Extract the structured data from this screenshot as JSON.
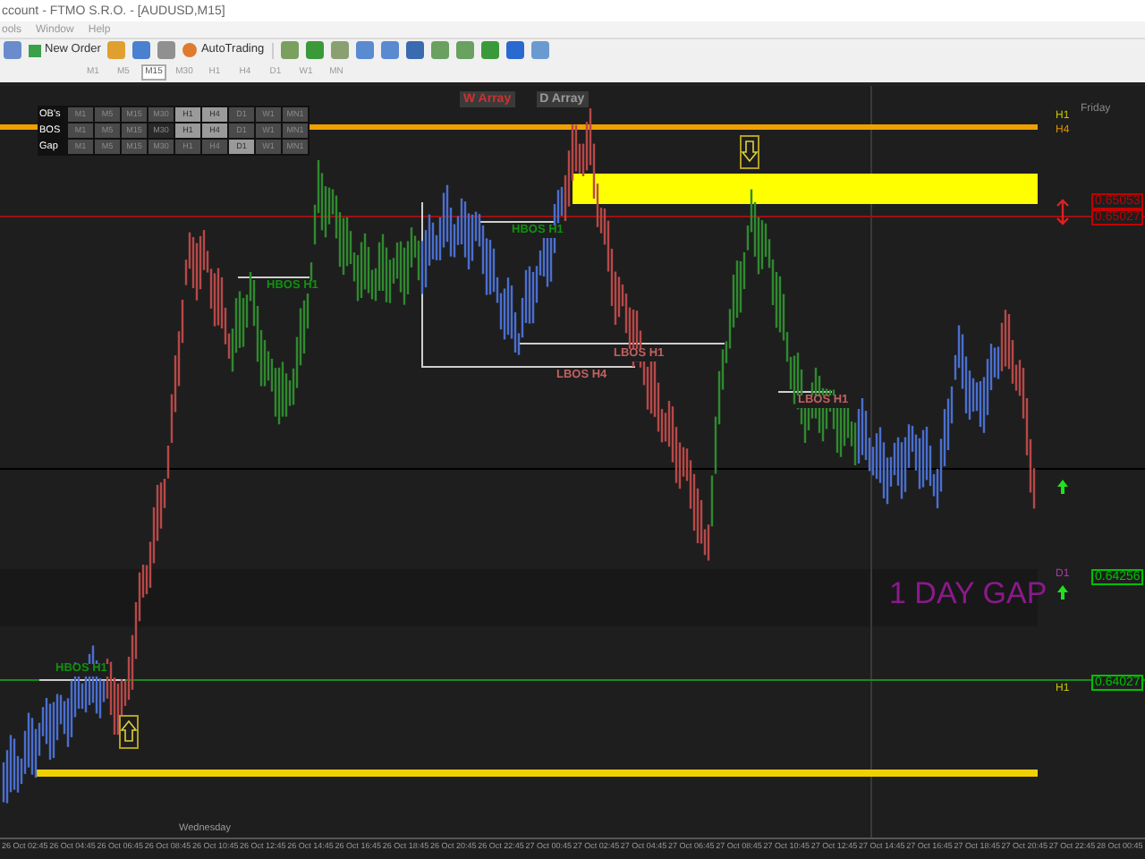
{
  "window": {
    "title": "ccount - FTMO S.R.O. - [AUDUSD,M15]"
  },
  "menu": [
    "ools",
    "Window",
    "Help"
  ],
  "toolbar": {
    "new_order": "New Order",
    "autotrading": "AutoTrading"
  },
  "timeframes": [
    {
      "label": "M1",
      "selected": false
    },
    {
      "label": "M5",
      "selected": false
    },
    {
      "label": "M15",
      "selected": true
    },
    {
      "label": "M30",
      "selected": false
    },
    {
      "label": "H1",
      "selected": false
    },
    {
      "label": "H4",
      "selected": false
    },
    {
      "label": "D1",
      "selected": false
    },
    {
      "label": "W1",
      "selected": false
    },
    {
      "label": "MN",
      "selected": false
    }
  ],
  "chart": {
    "array_buttons": [
      {
        "label": "W Array",
        "color": "#d03030"
      },
      {
        "label": "D Array",
        "color": "#9a9a9a"
      }
    ],
    "panel": [
      {
        "label": "OB's",
        "cells": [
          {
            "label": "M1",
            "on": false,
            "pressed": false
          },
          {
            "label": "M5",
            "on": false,
            "pressed": false
          },
          {
            "label": "M15",
            "on": false,
            "pressed": false
          },
          {
            "label": "M30",
            "on": false,
            "pressed": false
          },
          {
            "label": "H1",
            "on": true,
            "pressed": false
          },
          {
            "label": "H4",
            "on": true,
            "pressed": false
          },
          {
            "label": "D1",
            "on": false,
            "pressed": false
          },
          {
            "label": "W1",
            "on": false,
            "pressed": false
          },
          {
            "label": "MN1",
            "on": false,
            "pressed": false
          }
        ]
      },
      {
        "label": "BOS",
        "cells": [
          {
            "label": "M1",
            "on": false,
            "pressed": false
          },
          {
            "label": "M5",
            "on": false,
            "pressed": false
          },
          {
            "label": "M15",
            "on": false,
            "pressed": false
          },
          {
            "label": "M30",
            "on": false,
            "pressed": true
          },
          {
            "label": "H1",
            "on": true,
            "pressed": false
          },
          {
            "label": "H4",
            "on": true,
            "pressed": false
          },
          {
            "label": "D1",
            "on": false,
            "pressed": false
          },
          {
            "label": "W1",
            "on": false,
            "pressed": false
          },
          {
            "label": "MN1",
            "on": false,
            "pressed": false
          }
        ]
      },
      {
        "label": "Gap",
        "cells": [
          {
            "label": "M1",
            "on": false,
            "pressed": false
          },
          {
            "label": "M5",
            "on": false,
            "pressed": false
          },
          {
            "label": "M15",
            "on": false,
            "pressed": false
          },
          {
            "label": "M30",
            "on": false,
            "pressed": false
          },
          {
            "label": "H1",
            "on": false,
            "pressed": false
          },
          {
            "label": "H4",
            "on": false,
            "pressed": false
          },
          {
            "label": "D1",
            "on": true,
            "pressed": false
          },
          {
            "label": "W1",
            "on": false,
            "pressed": false
          },
          {
            "label": "MN1",
            "on": false,
            "pressed": false
          }
        ]
      }
    ],
    "day_label": "Friday",
    "week_label": "Wednesday",
    "tf_marks": [
      {
        "text": "H1",
        "color": "#c8c800"
      },
      {
        "text": "H4",
        "color": "#e09000"
      },
      {
        "text": "D1",
        "color": "#a040a0"
      },
      {
        "text": "H1",
        "color": "#c8c800"
      }
    ],
    "price_tags": [
      {
        "text": "0.65053",
        "color": "#c00000"
      },
      {
        "text": "0.65027",
        "color": "#c00000"
      },
      {
        "text": "0.64256",
        "color": "#00c000"
      },
      {
        "text": "0.64027",
        "color": "#00c000"
      }
    ],
    "bos_labels": [
      {
        "text": "HBOS H1",
        "color": "#109010"
      },
      {
        "text": "HBOS H1",
        "color": "#109010"
      },
      {
        "text": "LBOS H1",
        "color": "#c06060"
      },
      {
        "text": "LBOS H4",
        "color": "#c06060"
      },
      {
        "text": "LBOS H1",
        "color": "#c06060"
      },
      {
        "text": "HBOS H1",
        "color": "#109010"
      }
    ],
    "gap_label": "1 DAY GAP"
  },
  "time_axis": [
    "26 Oct 02:45",
    "26 Oct 04:45",
    "26 Oct 06:45",
    "26 Oct 08:45",
    "26 Oct 10:45",
    "26 Oct 12:45",
    "26 Oct 14:45",
    "26 Oct 16:45",
    "26 Oct 18:45",
    "26 Oct 20:45",
    "26 Oct 22:45",
    "27 Oct 00:45",
    "27 Oct 02:45",
    "27 Oct 04:45",
    "27 Oct 06:45",
    "27 Oct 08:45",
    "27 Oct 10:45",
    "27 Oct 12:45",
    "27 Oct 14:45",
    "27 Oct 16:45",
    "27 Oct 18:45",
    "27 Oct 20:45",
    "27 Oct 22:45",
    "28 Oct 00:45"
  ]
}
